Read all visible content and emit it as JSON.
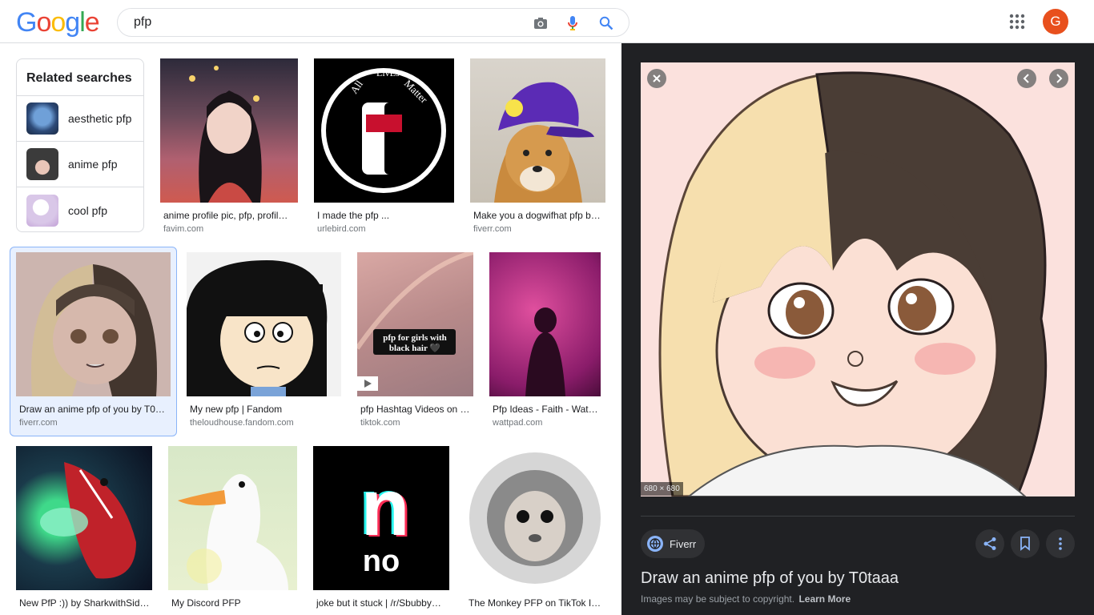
{
  "header": {
    "logo_letters": [
      {
        "char": "G",
        "color": "#4285F4"
      },
      {
        "char": "o",
        "color": "#EA4335"
      },
      {
        "char": "o",
        "color": "#FBBC05"
      },
      {
        "char": "g",
        "color": "#4285F4"
      },
      {
        "char": "l",
        "color": "#34A853"
      },
      {
        "char": "e",
        "color": "#EA4335"
      }
    ],
    "search_value": "pfp",
    "avatar_letter": "G",
    "avatar_color": "#e8501d"
  },
  "related": {
    "title": "Related searches",
    "items": [
      {
        "label": "aesthetic pfp"
      },
      {
        "label": "anime pfp"
      },
      {
        "label": "cool pfp"
      }
    ]
  },
  "results": [
    {
      "caption": "anime profile pic, pfp, profil…",
      "source": "favim.com"
    },
    {
      "caption": "I made the pfp ...",
      "source": "urlebird.com"
    },
    {
      "caption": "Make you a dogwifhat pfp b…",
      "source": "fiverr.com"
    },
    {
      "caption": "Draw an anime pfp of you by T0…",
      "source": "fiverr.com"
    },
    {
      "caption": "My new pfp | Fandom",
      "source": "theloudhouse.fandom.com"
    },
    {
      "caption": "pfp Hashtag Videos on …",
      "source": "tiktok.com"
    },
    {
      "caption": "Pfp Ideas - Faith - Watt…",
      "source": "wattpad.com"
    },
    {
      "caption": "New PfP :)) by SharkwithSid…",
      "source": ""
    },
    {
      "caption": "My Discord PFP",
      "source": ""
    },
    {
      "caption": "joke but it stuck | /r/Sbubby…",
      "source": ""
    },
    {
      "caption": "The Monkey PFP on TikTok I…",
      "source": ""
    }
  ],
  "image_text": {
    "all_lives_matter": [
      "LivEs",
      "All",
      "Matter"
    ],
    "tiktok_overlay": "pfp for girls with black hair 🖤",
    "no_logo": [
      "n",
      "no"
    ]
  },
  "preview": {
    "dimensions": "680 × 680",
    "site_name": "Fiverr",
    "title": "Draw an anime pfp of you by T0taaa",
    "copyright_text": "Images may be subject to copyright.",
    "learn_more": "Learn More"
  }
}
